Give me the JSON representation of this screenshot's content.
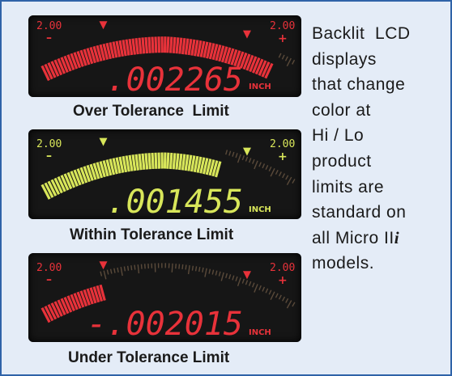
{
  "displays": [
    {
      "id": "over",
      "scale_left": "2.00",
      "scale_left_sign": "–",
      "scale_right": "2.00",
      "scale_right_sign": "+",
      "reading": ".002265",
      "unit": "INCH",
      "caption": "Over Tolerance  Limit",
      "lit_color": "#e8323a",
      "bar_fraction": 0.94,
      "marker_positions": [
        0.25,
        0.83
      ]
    },
    {
      "id": "within",
      "scale_left": "2.00",
      "scale_left_sign": "–",
      "scale_right": "2.00",
      "scale_right_sign": "+",
      "reading": ".001455",
      "unit": "INCH",
      "caption": "Within Tolerance Limit",
      "lit_color": "#d8e65a",
      "bar_fraction": 0.73,
      "marker_positions": [
        0.25,
        0.83
      ]
    },
    {
      "id": "under",
      "scale_left": "2.00",
      "scale_left_sign": "–",
      "scale_right": "2.00",
      "scale_right_sign": "+",
      "reading": "-.002015",
      "unit": "INCH",
      "caption": "Under Tolerance Limit",
      "lit_color": "#e8323a",
      "bar_fraction": 0.24,
      "marker_positions": [
        0.25,
        0.83
      ]
    }
  ],
  "description": {
    "lines": [
      "Backlit  LCD",
      "displays",
      "that change",
      "color at",
      "Hi / Lo",
      "product",
      "limits are",
      "standard on",
      "all Micro II",
      "models."
    ],
    "model_suffix": "i"
  },
  "colors": {
    "frame_border": "#2f63a8",
    "panel_background": "#e4ecf7",
    "lcd_background": "#161616"
  }
}
